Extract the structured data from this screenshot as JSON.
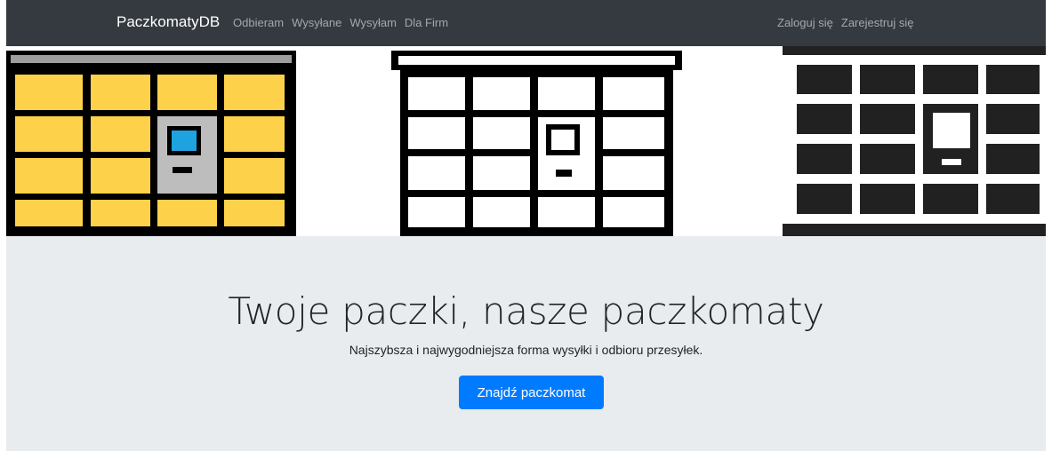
{
  "navbar": {
    "brand": "PaczkomatyDB",
    "links": [
      "Odbieram",
      "Wysyłane",
      "Wysyłam",
      "Dla Firm"
    ],
    "auth_links": [
      "Zaloguj się",
      "Zarejestruj się"
    ]
  },
  "hero": {
    "title": "Twoje paczki, nasze paczkomaty",
    "subtitle": "Najszybsza i najwygodniejsza forma wysyłki i odbioru przesyłek.",
    "button_label": "Znajdź paczkomat"
  },
  "banner": {
    "icons": [
      "parcel-locker-yellow-icon",
      "parcel-locker-outline-icon",
      "parcel-locker-black-icon"
    ]
  },
  "colors": {
    "navbar_bg": "#343a40",
    "jumbotron_bg": "#e9ecef",
    "primary": "#007bff",
    "locker_yellow": "#fdd14a",
    "screen_blue": "#1ea3e0"
  }
}
